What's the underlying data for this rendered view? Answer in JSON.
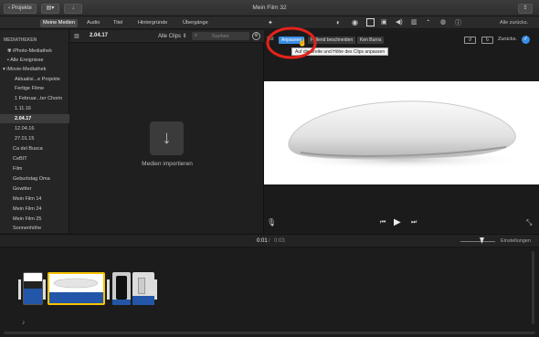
{
  "window": {
    "title": "Mein Film 32"
  },
  "titlebar": {
    "projects_label": "Projekte"
  },
  "tabs": [
    "Meine Medien",
    "Audio",
    "Titel",
    "Hintergründe",
    "Übergänge"
  ],
  "toolbar_right": {
    "reset_all_label": "Alle zurücks."
  },
  "sidebar": {
    "section_header": "MEDIATHEKEN",
    "items": [
      {
        "label": "iPhoto-Mediathek",
        "type": "library"
      },
      {
        "label": "Alle Ereignisse",
        "type": "library"
      },
      {
        "label": "iMovie-Mediathek",
        "type": "library"
      },
      {
        "label": "Aktualisi...e Projekte",
        "type": "event"
      },
      {
        "label": "Fertige Filme",
        "type": "event"
      },
      {
        "label": "1 Februar...ter Chorin",
        "type": "event"
      },
      {
        "label": "1.11.16",
        "type": "event"
      },
      {
        "label": "2.04.17",
        "type": "event",
        "selected": true
      },
      {
        "label": "12.04.16",
        "type": "event"
      },
      {
        "label": "27.01.15",
        "type": "event"
      },
      {
        "label": "Ca del Busca",
        "type": "event"
      },
      {
        "label": "CeBIT",
        "type": "event"
      },
      {
        "label": "Film",
        "type": "event"
      },
      {
        "label": "Geburtstag Oma",
        "type": "event"
      },
      {
        "label": "Gewitter",
        "type": "event"
      },
      {
        "label": "Mein Film 14",
        "type": "event"
      },
      {
        "label": "Mein Film 24",
        "type": "event"
      },
      {
        "label": "Mein Film 25",
        "type": "event"
      },
      {
        "label": "Sonnenhöhe",
        "type": "event"
      }
    ]
  },
  "browser": {
    "event_title": "2.04.17",
    "filter_label": "Alle Clips",
    "search_placeholder": "Suchen",
    "import_label": "Medien importieren"
  },
  "viewer": {
    "crop_label": "Stil:",
    "crop_buttons": [
      "Anpassen",
      "Füllend beschneiden",
      "Ken Burns"
    ],
    "reset_label": "Zurücks.",
    "tooltip": "Auf die Breite und Höhe des Clips anpassen"
  },
  "timeline": {
    "current_time": "0:01",
    "separator": "/",
    "total_time": "0:03",
    "settings_label": "Einstellungen"
  },
  "colors": {
    "accent": "#3a8ee6",
    "annotation_circle": "#e2231a",
    "clip_selected_border": "#f5c400",
    "clip_blue": "#2356a8"
  },
  "icons": [
    "chevron-left-icon",
    "library-icon",
    "share-icon",
    "import-arrow-icon",
    "magic-wand-icon",
    "color-balance-icon",
    "color-wheel-icon",
    "crop-icon",
    "camera-icon",
    "volume-icon",
    "speedometer-icon",
    "noise-icon",
    "filter-icon",
    "info-icon",
    "microphone-icon",
    "previous-icon",
    "play-icon",
    "next-icon",
    "fullscreen-icon",
    "music-note-icon"
  ]
}
